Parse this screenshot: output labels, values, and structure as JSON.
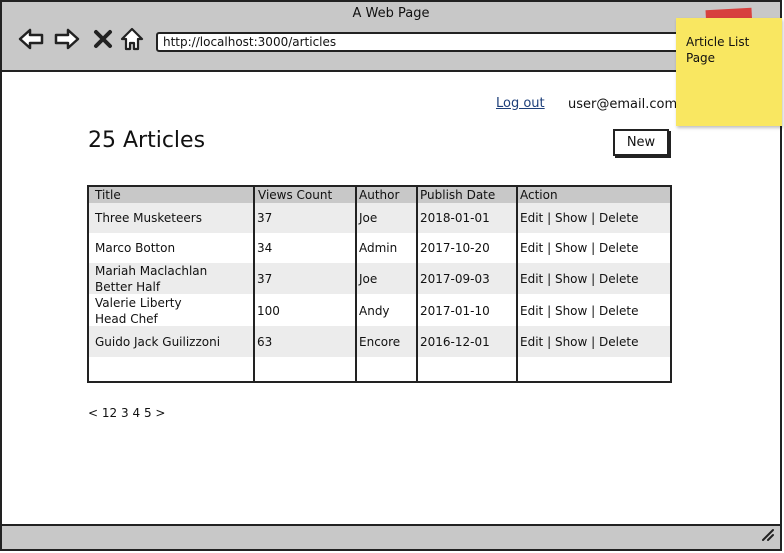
{
  "window": {
    "title": "A Web Page"
  },
  "browser": {
    "url": "http://localhost:3000/articles"
  },
  "sticky_note": {
    "text": "Article List Page",
    "color": "#f9e761"
  },
  "header": {
    "logout_label": "Log out",
    "user_email": "user@email.com"
  },
  "page": {
    "heading": "25 Articles",
    "new_button": "New"
  },
  "table": {
    "columns": [
      "Title",
      "Views Count",
      "Author",
      "Publish Date",
      "Action"
    ],
    "rows": [
      {
        "title_lines": [
          "Three Musketeers"
        ],
        "views": "37",
        "author": "Joe",
        "date": "2018-01-01",
        "actions": [
          "Edit",
          "Show",
          "Delete"
        ]
      },
      {
        "title_lines": [
          "Marco Botton"
        ],
        "views": "34",
        "author": "Admin",
        "date": "2017-10-20",
        "actions": [
          "Edit",
          "Show",
          "Delete"
        ]
      },
      {
        "title_lines": [
          "Mariah Maclachlan",
          "Better Half"
        ],
        "views": "37",
        "author": "Joe",
        "date": "2017-09-03",
        "actions": [
          "Edit",
          "Show",
          "Delete"
        ]
      },
      {
        "title_lines": [
          "Valerie Liberty",
          "Head Chef"
        ],
        "views": "100",
        "author": "Andy",
        "date": "2017-01-10",
        "actions": [
          "Edit",
          "Show",
          "Delete"
        ]
      },
      {
        "title_lines": [
          "Guido Jack Guilizzoni"
        ],
        "views": "63",
        "author": "Encore",
        "date": "2016-12-01",
        "actions": [
          "Edit",
          "Show",
          "Delete"
        ]
      }
    ],
    "action_separator": "|"
  },
  "pagination": {
    "prev": "<",
    "pages": [
      "1",
      "2",
      "3",
      "4",
      "5"
    ],
    "next": ">"
  },
  "icons": {
    "back": "arrow-left-icon",
    "forward": "arrow-right-icon",
    "stop": "close-icon",
    "home": "home-icon",
    "resize": "resize-grip-icon"
  }
}
